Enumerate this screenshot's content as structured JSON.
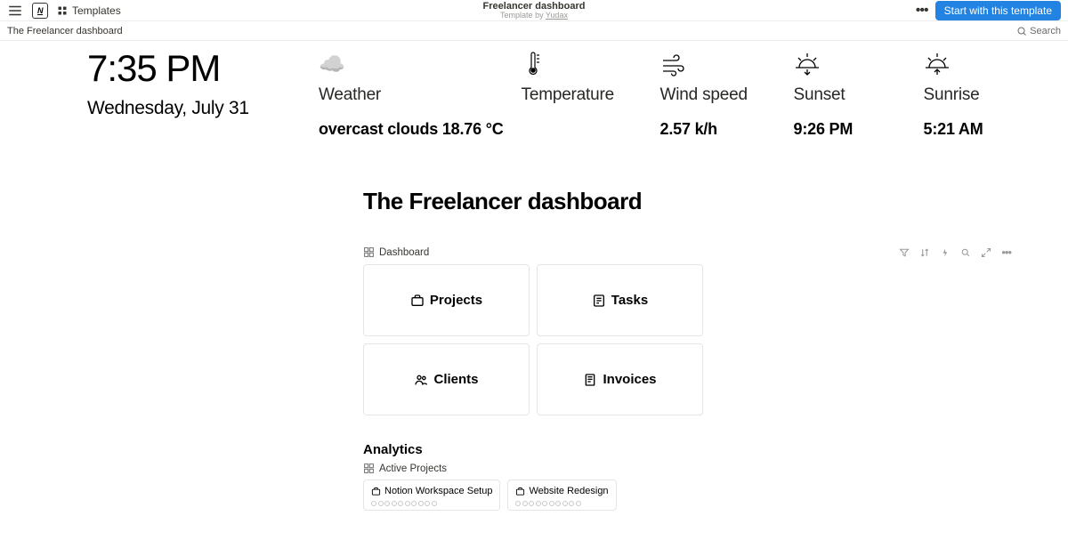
{
  "topbar": {
    "templates_label": "Templates",
    "title": "Freelancer dashboard",
    "subtitle_prefix": "Template by ",
    "author": "Yudax",
    "start_button": "Start with this template"
  },
  "breadcrumb": "The Freelancer dashboard",
  "search_label": "Search",
  "hero": {
    "time": "7:35 PM",
    "date": "Wednesday, July 31"
  },
  "weather": {
    "label_weather": "Weather",
    "label_temperature": "Temperature",
    "label_wind": "Wind speed",
    "label_sunset": "Sunset",
    "label_sunrise": "Sunrise",
    "value_conditions": "overcast clouds",
    "value_temp": "18.76 °C",
    "value_wind": "2.57 k/h",
    "value_sunset": "9:26 PM",
    "value_sunrise": "5:21 AM"
  },
  "main": {
    "heading": "The Freelancer dashboard",
    "dashboard_view_title": "Dashboard",
    "cards": {
      "projects": "Projects",
      "tasks": "Tasks",
      "clients": "Clients",
      "invoices": "Invoices"
    },
    "analytics_heading": "Analytics",
    "active_projects_view": "Active Projects",
    "project1": "Notion Workspace Setup",
    "project2": "Website Redesign"
  }
}
